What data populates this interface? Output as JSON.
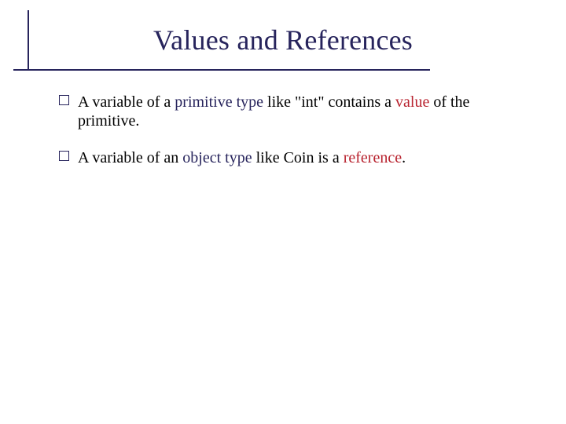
{
  "title": "Values and References",
  "bullets": [
    {
      "pre": "A variable of a ",
      "em1": "primitive type",
      "mid": " like \"int\" contains a ",
      "em2": "value",
      "post": " of the primitive."
    },
    {
      "pre": "A variable of an ",
      "em1": "object type",
      "mid": " like Coin is a ",
      "em2": "reference",
      "post": "."
    }
  ]
}
